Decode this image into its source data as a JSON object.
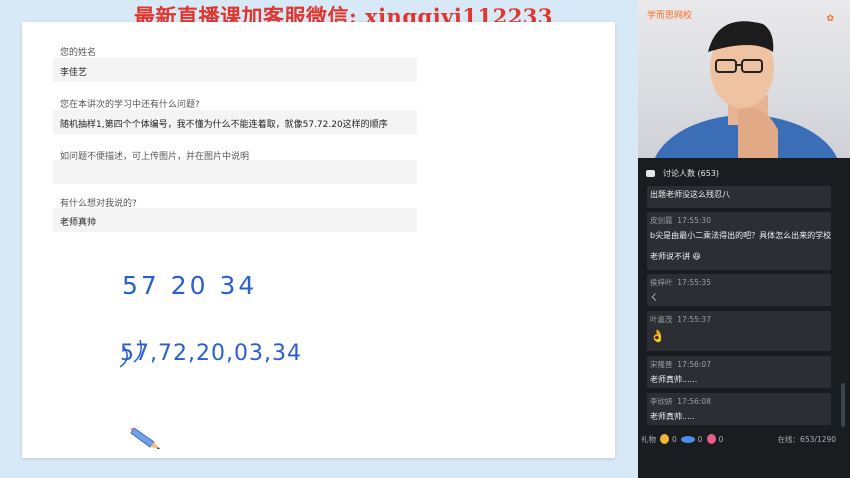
{
  "watermark": "最新直播课加客服微信: xingqiyi112233",
  "form": {
    "q1": {
      "label": "您的姓名",
      "answer": "李佳艺"
    },
    "q2": {
      "label": "您在本讲次的学习中还有什么问题?",
      "answer": "随机抽样1,第四个个体编号，我不懂为什么不能连着取，就像57.72.20这样的顺序"
    },
    "q3": {
      "label": "如问题不便描述，可上传图片，并在图片中说明",
      "answer": ""
    },
    "q4": {
      "label": "有什么想对我说的?",
      "answer": "老师真帅"
    }
  },
  "handwriting": {
    "line1": "57 20 34",
    "line2": "57,72,20,03,34"
  },
  "video": {
    "brand": "学而思网校"
  },
  "chat": {
    "header": "讨论人数 (653)",
    "partial_text": "出题老师没这么残忍八",
    "messages": [
      {
        "user": "皮剑晨",
        "time": "17:55:30",
        "text": "b尖是由最小二乘法得出的吧？具体怎么出来的学校",
        "text2": "老师说不讲"
      },
      {
        "user": "侯梓叶",
        "time": "17:55:35",
        "text": "ㄑ"
      },
      {
        "user": "叶嘉茂",
        "time": "17:55:37",
        "text": "👌"
      },
      {
        "user": "宋隆晋",
        "time": "17:56:07",
        "text": "老师真帅......"
      },
      {
        "user": "李欣妍",
        "time": "17:56:08",
        "text": "老师真帅....."
      }
    ]
  },
  "footer": {
    "gift_label": "礼物",
    "gift_counts": [
      "0",
      "0",
      "0"
    ],
    "online": "在线：653/1290"
  },
  "colors": {
    "accent": "#ff6a1a",
    "watermark": "#e0362d",
    "ink": "#2a5fd0"
  }
}
